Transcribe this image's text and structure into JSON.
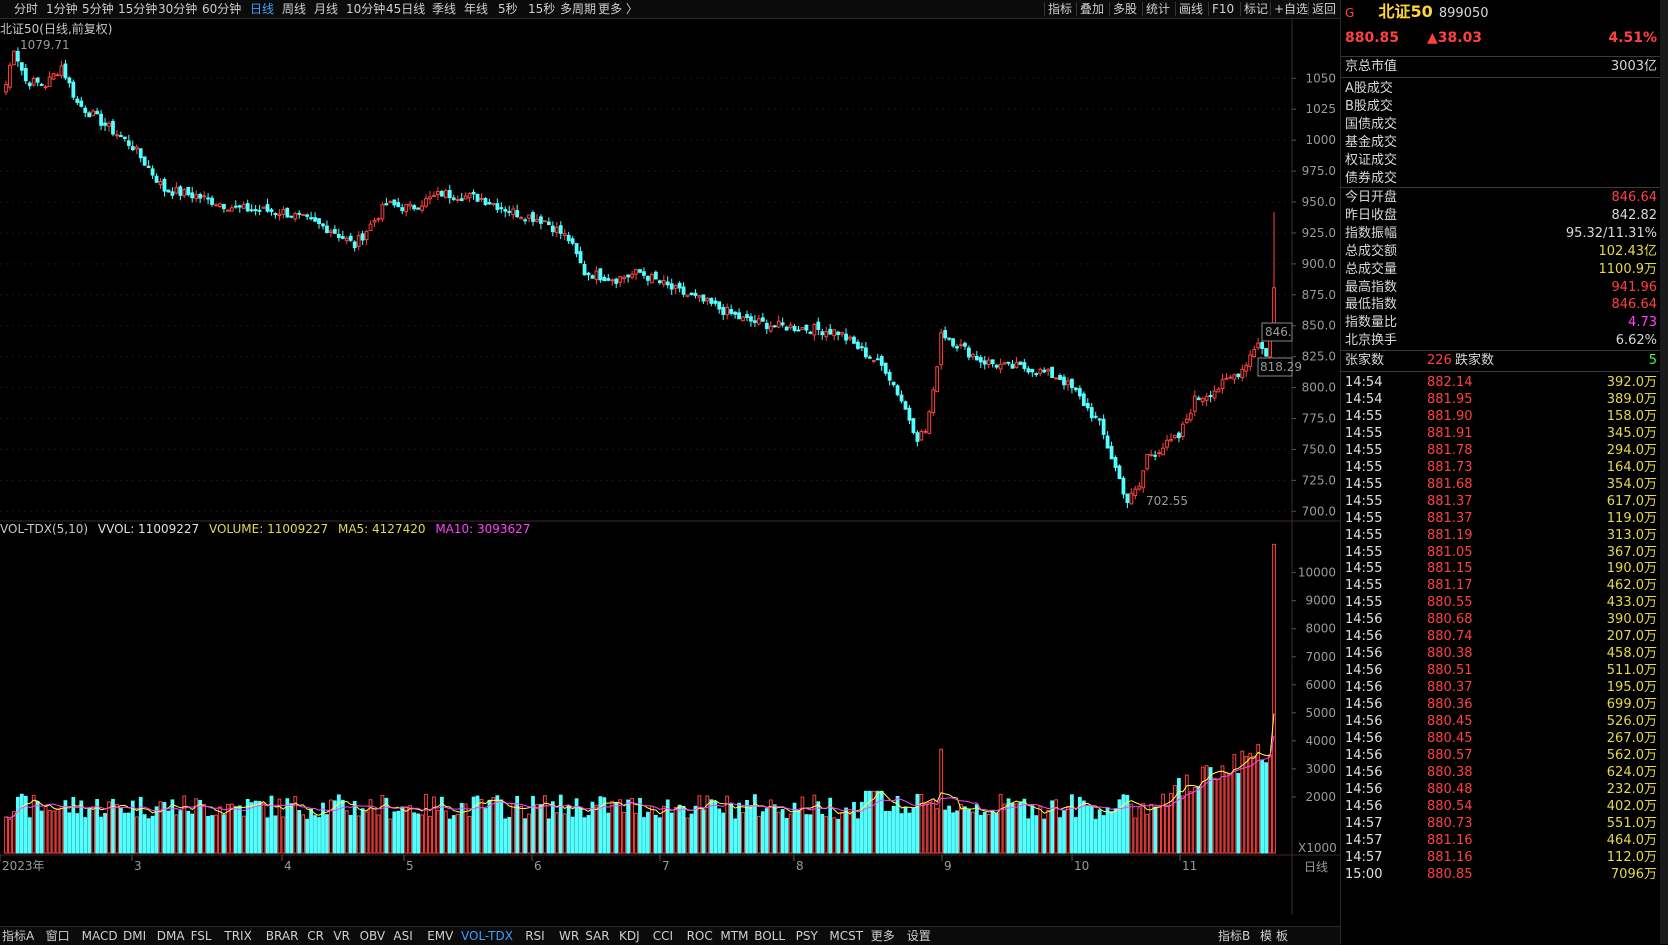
{
  "toolbar": {
    "periods": [
      "分时",
      "1分钟",
      "5分钟",
      "15分钟",
      "30分钟",
      "60分钟",
      "日线",
      "周线",
      "月线",
      "10分钟",
      "45日线",
      "季线",
      "年线",
      "5秒",
      "15秒",
      "多周期",
      "更多 〉"
    ],
    "active_period": "日线",
    "tools": [
      "指标",
      "叠加",
      "多股",
      "统计",
      "画线",
      "F10",
      "标记",
      "+自选",
      "返回"
    ]
  },
  "chart": {
    "title": "北证50(日线,前复权)",
    "high_label": "1079.71",
    "low_label": "702.55",
    "price_label_1": "846.",
    "price_label_2": "818.29",
    "y_ticks": [
      "1050",
      "1025",
      "1000",
      "975.0",
      "950.0",
      "925.0",
      "900.0",
      "875.0",
      "850.0",
      "825.0",
      "800.0",
      "775.0",
      "750.0",
      "725.0",
      "700.0"
    ],
    "x_labels": [
      "2023年",
      "3",
      "4",
      "5",
      "6",
      "7",
      "8",
      "9",
      "10",
      "11"
    ],
    "vol_y_ticks": [
      "10000",
      "9000",
      "8000",
      "7000",
      "6000",
      "5000",
      "4000",
      "3000",
      "2000"
    ],
    "vol_unit": "X1000",
    "period_corner": "日线",
    "colors": {
      "up": "#ff4040",
      "down": "#54ffff",
      "ma5": "#ffff40",
      "ma10": "#ff40ff",
      "grid": "#2a1a1a"
    }
  },
  "volume": {
    "indicator": "VOL-TDX(5,10)",
    "vvol": "VVOL: 11009227",
    "volume": "VOLUME: 11009227",
    "ma5": "MA5: 4127420",
    "ma10": "MA10: 3093627"
  },
  "chart_data": {
    "type": "candlestick",
    "title": "北证50(日线,前复权)",
    "ylim": [
      697,
      1085
    ],
    "series_summary": {
      "period_high": 1079.71,
      "period_low": 702.55,
      "last_open": 846.64,
      "last_high": 941.96,
      "last_low": 846.64,
      "last_close": 880.85
    },
    "x_month_labels": [
      "2023年",
      "3",
      "4",
      "5",
      "6",
      "7",
      "8",
      "9",
      "10",
      "11"
    ]
  },
  "bottom_tabs": [
    "指标A",
    "窗口",
    "MACD",
    "DMI",
    "DMA",
    "FSL",
    "TRIX",
    "BRAR",
    "CR",
    "VR",
    "OBV",
    "ASI",
    "EMV",
    "VOL-TDX",
    "RSI",
    "WR",
    "SAR",
    "KDJ",
    "CCI",
    "ROC",
    "MTM",
    "BOLL",
    "PSY",
    "MCST",
    "更多",
    "设置"
  ],
  "bottom_active": "VOL-TDX",
  "bottom_right": [
    "指标B",
    "模",
    "板"
  ],
  "panel": {
    "flag": "G",
    "name": "北证50",
    "code": "899050",
    "price": "880.85",
    "change": "▲38.03",
    "change_pct": "4.51%",
    "market_cap_label": "京总市值",
    "market_cap_value": "3003亿",
    "categories": [
      "A股成交",
      "B股成交",
      "国债成交",
      "基金成交",
      "权证成交",
      "债券成交"
    ],
    "stats": [
      {
        "label": "今日开盘",
        "value": "846.64",
        "color": "#ff4040"
      },
      {
        "label": "昨日收盘",
        "value": "842.82",
        "color": "#d8d8d8"
      },
      {
        "label": "指数振幅",
        "value": "95.32/11.31%",
        "color": "#d8d8d8"
      },
      {
        "label": "总成交额",
        "value": "102.43亿",
        "color": "#e6d84a"
      },
      {
        "label": "总成交量",
        "value": "1100.9万",
        "color": "#e6d84a"
      },
      {
        "label": "最高指数",
        "value": "941.96",
        "color": "#ff4040"
      },
      {
        "label": "最低指数",
        "value": "846.64",
        "color": "#ff4040"
      },
      {
        "label": "指数量比",
        "value": "4.73",
        "color": "#ff40ff"
      },
      {
        "label": "北京换手",
        "value": "6.62%",
        "color": "#d8d8d8"
      }
    ],
    "up_label": "张家数",
    "up_count": "226",
    "down_label": "跌家数",
    "down_count": "5",
    "ticks": [
      {
        "t": "14:54",
        "p": "882.14",
        "v": "392.0万"
      },
      {
        "t": "14:54",
        "p": "881.95",
        "v": "389.0万"
      },
      {
        "t": "14:55",
        "p": "881.90",
        "v": "158.0万"
      },
      {
        "t": "14:55",
        "p": "881.91",
        "v": "345.0万"
      },
      {
        "t": "14:55",
        "p": "881.78",
        "v": "294.0万"
      },
      {
        "t": "14:55",
        "p": "881.73",
        "v": "164.0万"
      },
      {
        "t": "14:55",
        "p": "881.68",
        "v": "354.0万"
      },
      {
        "t": "14:55",
        "p": "881.37",
        "v": "617.0万"
      },
      {
        "t": "14:55",
        "p": "881.37",
        "v": "119.0万"
      },
      {
        "t": "14:55",
        "p": "881.19",
        "v": "313.0万"
      },
      {
        "t": "14:55",
        "p": "881.05",
        "v": "367.0万"
      },
      {
        "t": "14:55",
        "p": "881.15",
        "v": "190.0万"
      },
      {
        "t": "14:55",
        "p": "881.17",
        "v": "462.0万"
      },
      {
        "t": "14:55",
        "p": "880.55",
        "v": "433.0万"
      },
      {
        "t": "14:56",
        "p": "880.68",
        "v": "390.0万"
      },
      {
        "t": "14:56",
        "p": "880.74",
        "v": "207.0万"
      },
      {
        "t": "14:56",
        "p": "880.38",
        "v": "458.0万"
      },
      {
        "t": "14:56",
        "p": "880.51",
        "v": "511.0万"
      },
      {
        "t": "14:56",
        "p": "880.37",
        "v": "195.0万"
      },
      {
        "t": "14:56",
        "p": "880.36",
        "v": "699.0万"
      },
      {
        "t": "14:56",
        "p": "880.45",
        "v": "526.0万"
      },
      {
        "t": "14:56",
        "p": "880.45",
        "v": "267.0万"
      },
      {
        "t": "14:56",
        "p": "880.57",
        "v": "562.0万"
      },
      {
        "t": "14:56",
        "p": "880.38",
        "v": "624.0万"
      },
      {
        "t": "14:56",
        "p": "880.48",
        "v": "232.0万"
      },
      {
        "t": "14:56",
        "p": "880.54",
        "v": "402.0万"
      },
      {
        "t": "14:57",
        "p": "880.73",
        "v": "551.0万"
      },
      {
        "t": "14:57",
        "p": "881.16",
        "v": "464.0万"
      },
      {
        "t": "14:57",
        "p": "881.16",
        "v": "112.0万"
      },
      {
        "t": "15:00",
        "p": "880.85",
        "v": "7096万"
      }
    ]
  }
}
